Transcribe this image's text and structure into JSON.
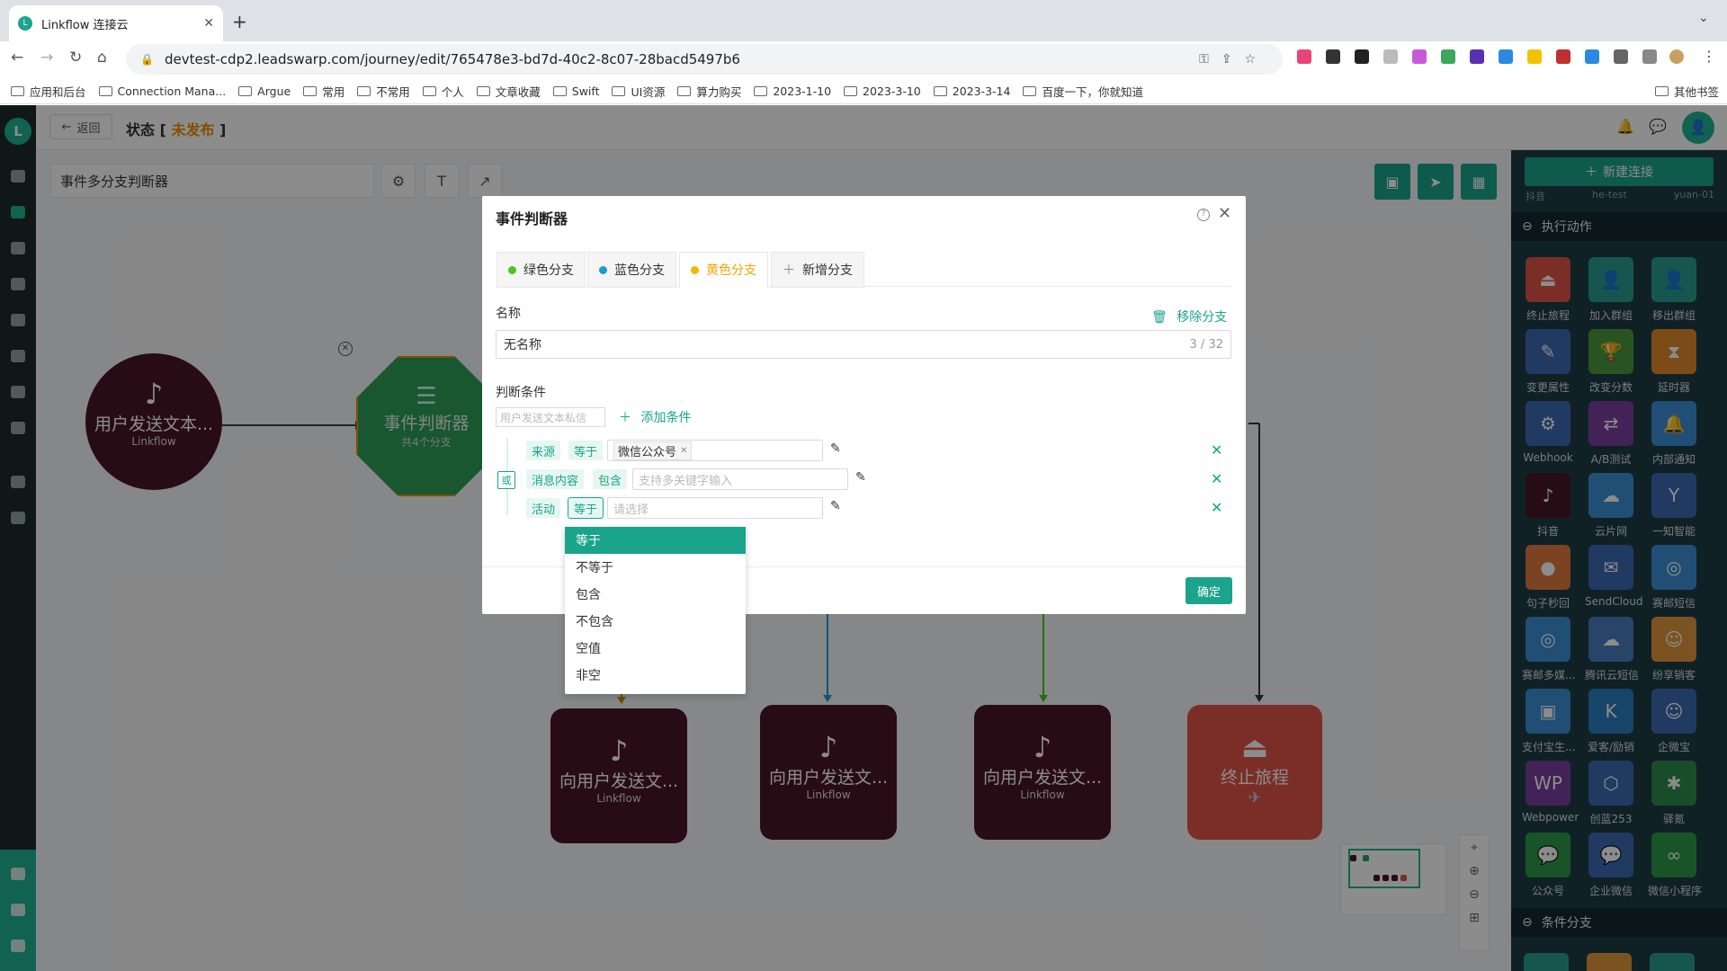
{
  "browser": {
    "tab_title": "Linkflow 连接云",
    "url": "devtest-cdp2.leadswarp.com/journey/edit/765478e3-bd7d-40c2-8c07-28bacd5497b6",
    "bookmarks": [
      "应用和后台",
      "Connection Mana...",
      "Argue",
      "常用",
      "不常用",
      "个人",
      "文章收藏",
      "Swift",
      "UI资源",
      "算力购买",
      "2023-1-10",
      "2023-3-10",
      "2023-3-14",
      "百度一下，你就知道"
    ],
    "other_bookmarks": "其他书签"
  },
  "header": {
    "back_label": "返回",
    "status_prefix": "状态 [ ",
    "status_value": "未发布",
    "status_suffix": " ]"
  },
  "canvas": {
    "journey_name": "事件多分支判断器",
    "nodes": {
      "start_title": "用户发送文本...",
      "start_sub": "Linkflow",
      "judge_title": "事件判断器",
      "judge_sub": "共4个分支",
      "b1_title": "向用户发送文...",
      "b1_sub": "Linkflow",
      "b2_title": "向用户发送文...",
      "b2_sub": "Linkflow",
      "b3_title": "向用户发送文...",
      "b3_sub": "Linkflow",
      "end_title": "终止旅程"
    }
  },
  "right_panel": {
    "new_connection": "新建连接",
    "top_partial": [
      "抖音",
      "he-test",
      "yuan-01"
    ],
    "section_actions": "执行动作",
    "section_branch": "条件分支",
    "actions": [
      {
        "label": "终止旅程",
        "color": "#e05548",
        "icon": "⏏"
      },
      {
        "label": "加入群组",
        "color": "#2a9d8f",
        "icon": "👤"
      },
      {
        "label": "移出群组",
        "color": "#2a9d8f",
        "icon": "👤"
      },
      {
        "label": "变更属性",
        "color": "#3d6bb3",
        "icon": "✎"
      },
      {
        "label": "改变分数",
        "color": "#4c9a3c",
        "icon": "🏆"
      },
      {
        "label": "延时器",
        "color": "#e08a2c",
        "icon": "⧗"
      },
      {
        "label": "Webhook",
        "color": "#3d6bb3",
        "icon": "⚙"
      },
      {
        "label": "A/B测试",
        "color": "#7b3fa0",
        "icon": "⇄"
      },
      {
        "label": "内部通知",
        "color": "#3d8fd6",
        "icon": "🔔"
      },
      {
        "label": "抖音",
        "color": "#4a1727",
        "icon": "♪"
      },
      {
        "label": "云片网",
        "color": "#3d8fd6",
        "icon": "☁"
      },
      {
        "label": "一知智能",
        "color": "#3d6bb3",
        "icon": "Y"
      },
      {
        "label": "句子秒回",
        "color": "#e07a3c",
        "icon": "●"
      },
      {
        "label": "SendCloud",
        "color": "#3d6bb3",
        "icon": "✉"
      },
      {
        "label": "赛邮短信",
        "color": "#3d8fd6",
        "icon": "◎"
      },
      {
        "label": "赛邮多媒...",
        "color": "#3d8fd6",
        "icon": "◎"
      },
      {
        "label": "腾讯云短信",
        "color": "#4a7ec0",
        "icon": "☁"
      },
      {
        "label": "纷享销客",
        "color": "#e0983c",
        "icon": "☺"
      },
      {
        "label": "支付宝生...",
        "color": "#3d8fd6",
        "icon": "▣"
      },
      {
        "label": "爱客/励销",
        "color": "#2a7ec0",
        "icon": "K"
      },
      {
        "label": "企微宝",
        "color": "#3d6bb3",
        "icon": "☺"
      },
      {
        "label": "Webpower",
        "color": "#7b3fa0",
        "icon": "WP"
      },
      {
        "label": "创蓝253",
        "color": "#3d6bb3",
        "icon": "⬡"
      },
      {
        "label": "驿氪",
        "color": "#2f8a4a",
        "icon": "✱"
      },
      {
        "label": "公众号",
        "color": "#2f9a4a",
        "icon": "💬"
      },
      {
        "label": "企业微信",
        "color": "#3d6bb3",
        "icon": "💬"
      },
      {
        "label": "微信小程序",
        "color": "#2f9a4a",
        "icon": "∞"
      }
    ]
  },
  "dialog": {
    "title": "事件判断器",
    "tabs": [
      {
        "label": "绿色分支",
        "color": "#52c41a"
      },
      {
        "label": "蓝色分支",
        "color": "#1c9bd6"
      },
      {
        "label": "黄色分支",
        "color": "#f2b705"
      },
      {
        "label": "新增分支",
        "color": ""
      }
    ],
    "name_label": "名称",
    "remove_branch": "移除分支",
    "name_value": "无名称",
    "name_count": "3 / 32",
    "cond_label": "判断条件",
    "cond_event": "用户发送文本私信",
    "add_condition": "添加条件",
    "or_label": "或",
    "conditions": [
      {
        "field": "来源",
        "op": "等于",
        "value_tag": "微信公众号",
        "placeholder": ""
      },
      {
        "field": "消息内容",
        "op": "包含",
        "value_tag": "",
        "placeholder": "支持多关键字输入"
      },
      {
        "field": "活动",
        "op": "等于",
        "value_tag": "",
        "placeholder": "请选择"
      }
    ],
    "ok_label": "确定",
    "dropdown_options": [
      "等于",
      "不等于",
      "包含",
      "不包含",
      "空值",
      "非空"
    ],
    "dropdown_selected": "等于"
  }
}
